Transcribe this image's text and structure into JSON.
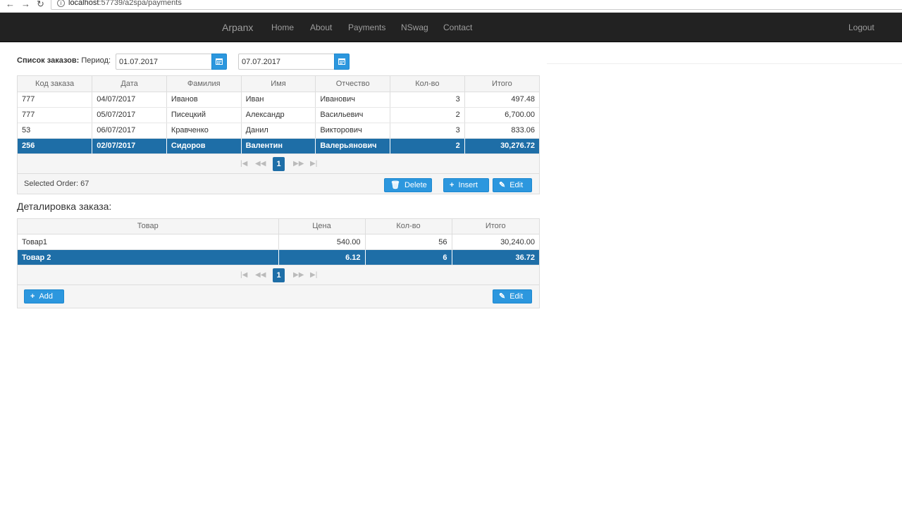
{
  "browser": {
    "url_host": "localhost",
    "url_rest": ":57739/a2spa/payments"
  },
  "navbar": {
    "brand": "Arpanx",
    "links": [
      "Home",
      "About",
      "Payments",
      "NSwag",
      "Contact"
    ],
    "logout": "Logout"
  },
  "orders": {
    "title_bold": "Список заказов:",
    "period_label": "Период:",
    "date_from": "01.07.2017",
    "date_to": "07.07.2017",
    "columns": [
      "Код заказа",
      "Дата",
      "Фамилия",
      "Имя",
      "Отчество",
      "Кол-во",
      "Итого"
    ],
    "rows": [
      [
        "777",
        "04/07/2017",
        "Иванов",
        "Иван",
        "Иванович",
        "3",
        "497.48"
      ],
      [
        "777",
        "05/07/2017",
        "Писецкий",
        "Александр",
        "Васильевич",
        "2",
        "6,700.00"
      ],
      [
        "53",
        "06/07/2017",
        "Кравченко",
        "Данил",
        "Викторович",
        "3",
        "833.06"
      ],
      [
        "256",
        "02/07/2017",
        "Сидоров",
        "Валентин",
        "Валерьянович",
        "2",
        "30,276.72"
      ]
    ],
    "selected_row": 3,
    "page": "1",
    "selected_text": "Selected Order: 67",
    "delete_label": "Delete",
    "insert_label": "Insert",
    "edit_label": "Edit"
  },
  "details": {
    "title": "Деталировка заказа:",
    "columns": [
      "Товар",
      "Цена",
      "Кол-во",
      "Итого"
    ],
    "rows": [
      [
        "Товар1",
        "540.00",
        "56",
        "30,240.00"
      ],
      [
        "Товар 2",
        "6.12",
        "6",
        "36.72"
      ]
    ],
    "selected_row": 1,
    "page": "1",
    "add_label": "Add",
    "edit_label": "Edit"
  },
  "colors": {
    "navbar": "#222222",
    "accent": "#2c97de",
    "selected": "#1e6ea7"
  }
}
